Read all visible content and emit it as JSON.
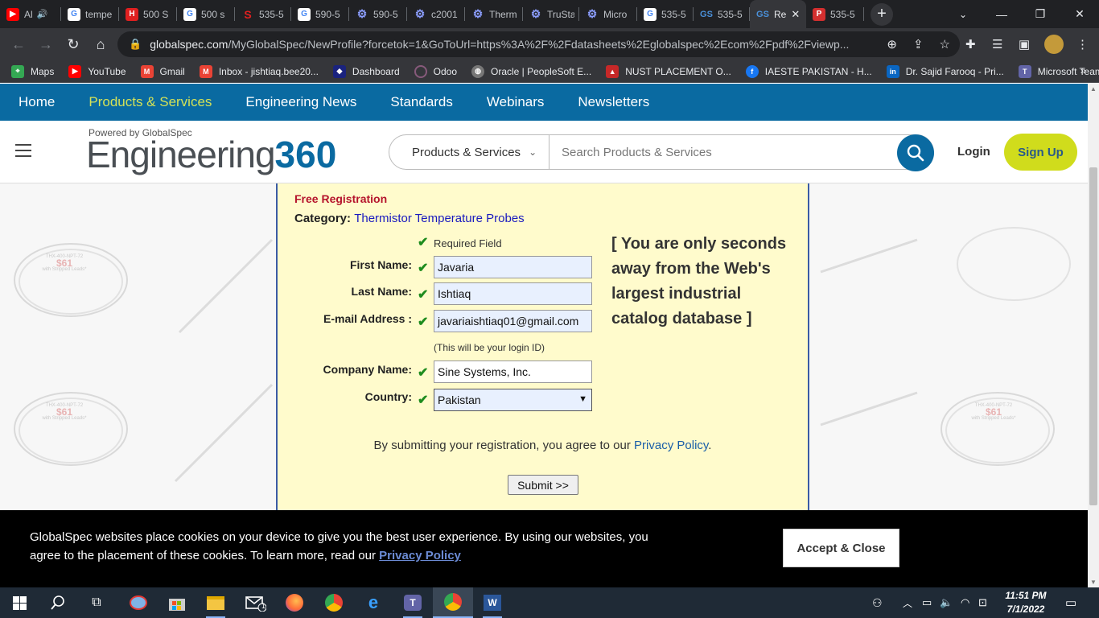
{
  "browser": {
    "tabs": [
      {
        "title": "Al",
        "icon": "youtube-icon",
        "color": "#ff0000"
      },
      {
        "title": "tempe",
        "icon": "google-icon",
        "color": "#4285f4"
      },
      {
        "title": "500 S",
        "icon": "h-icon",
        "color": "#e02020"
      },
      {
        "title": "500 s",
        "icon": "google-icon",
        "color": "#4285f4"
      },
      {
        "title": "535-5",
        "icon": "s-icon",
        "color": "#c62828"
      },
      {
        "title": "590-5",
        "icon": "google-icon",
        "color": "#4285f4"
      },
      {
        "title": "590-5",
        "icon": "gear-icon",
        "color": "#5c6bc0"
      },
      {
        "title": "c2001",
        "icon": "gear-icon",
        "color": "#5c6bc0"
      },
      {
        "title": "Therm",
        "icon": "gear-icon",
        "color": "#5c6bc0"
      },
      {
        "title": "TruSta",
        "icon": "gear-icon",
        "color": "#5c6bc0"
      },
      {
        "title": "Micro",
        "icon": "gear-icon",
        "color": "#5c6bc0"
      },
      {
        "title": "535-5",
        "icon": "google-icon",
        "color": "#4285f4"
      },
      {
        "title": "535-5",
        "icon": "gs-icon",
        "color": "#1565c0"
      },
      {
        "title": "Re",
        "icon": "gs-icon",
        "color": "#1565c0",
        "active": true
      },
      {
        "title": "535-5",
        "icon": "pdf-icon",
        "color": "#d32f2f"
      }
    ],
    "url_host": "globalspec.com",
    "url_path": "/MyGlobalSpec/NewProfile?forcetok=1&GoToUrl=https%3A%2F%2Fdatasheets%2Eglobalspec%2Ecom%2Fpdf%2Fviewp...",
    "bookmarks": [
      {
        "label": "Maps",
        "color": "#34a853"
      },
      {
        "label": "YouTube",
        "color": "#ff0000"
      },
      {
        "label": "Gmail",
        "color": "#ea4335"
      },
      {
        "label": "Inbox - jishtiaq.bee20...",
        "color": "#ea4335"
      },
      {
        "label": "Dashboard",
        "color": "#1a237e"
      },
      {
        "label": "Odoo",
        "color": "#875a7b"
      },
      {
        "label": "Oracle | PeopleSoft E...",
        "color": "#777777"
      },
      {
        "label": "NUST PLACEMENT O...",
        "color": "#c62828"
      },
      {
        "label": "IAESTE PAKISTAN - H...",
        "color": "#1877f2"
      },
      {
        "label": "Dr. Sajid Farooq - Pri...",
        "color": "#0a66c2"
      },
      {
        "label": "Microsoft Teams",
        "color": "#6264a7"
      }
    ]
  },
  "site": {
    "nav": [
      "Home",
      "Products & Services",
      "Engineering News",
      "Standards",
      "Webinars",
      "Newsletters"
    ],
    "logo_small": "Powered by GlobalSpec",
    "logo_main": "Engineering",
    "logo_num": "360",
    "category_select": "Products & Services",
    "search_placeholder": "Search Products & Services",
    "login": "Login",
    "signup": "Sign Up"
  },
  "form": {
    "heading": "Free Registration",
    "category_label": "Category:",
    "category_value": "Thermistor Temperature Probes",
    "required_note": "Required Field",
    "fields": {
      "first_name_label": "First Name:",
      "first_name": "Javaria",
      "last_name_label": "Last Name:",
      "last_name": "Ishtiaq",
      "email_label": "E-mail Address :",
      "email": "javariaishtiaq01@gmail.com",
      "email_hint": "(This will be your login ID)",
      "company_label": "Company Name:",
      "company": "Sine Systems, Inc.",
      "country_label": "Country:",
      "country": "Pakistan"
    },
    "promo": "[ You are only seconds away from the Web's largest industrial catalog database ]",
    "agree_text": "By submitting your registration, you agree to our",
    "privacy_link": "Privacy Policy",
    "agree_end": ".",
    "submit": "Submit >>"
  },
  "background_probe": {
    "model": "THX-400-NPT-72",
    "price": "$61",
    "note": "with Stripped Leads*"
  },
  "cookie": {
    "text": "GlobalSpec websites place cookies on your device to give you the best user experience. By using our websites, you agree to the placement of these cookies. To learn more, read our",
    "link": "Privacy Policy",
    "button": "Accept & Close"
  },
  "taskbar": {
    "time": "11:51 PM",
    "date": "7/1/2022",
    "mail_badge": "1"
  }
}
